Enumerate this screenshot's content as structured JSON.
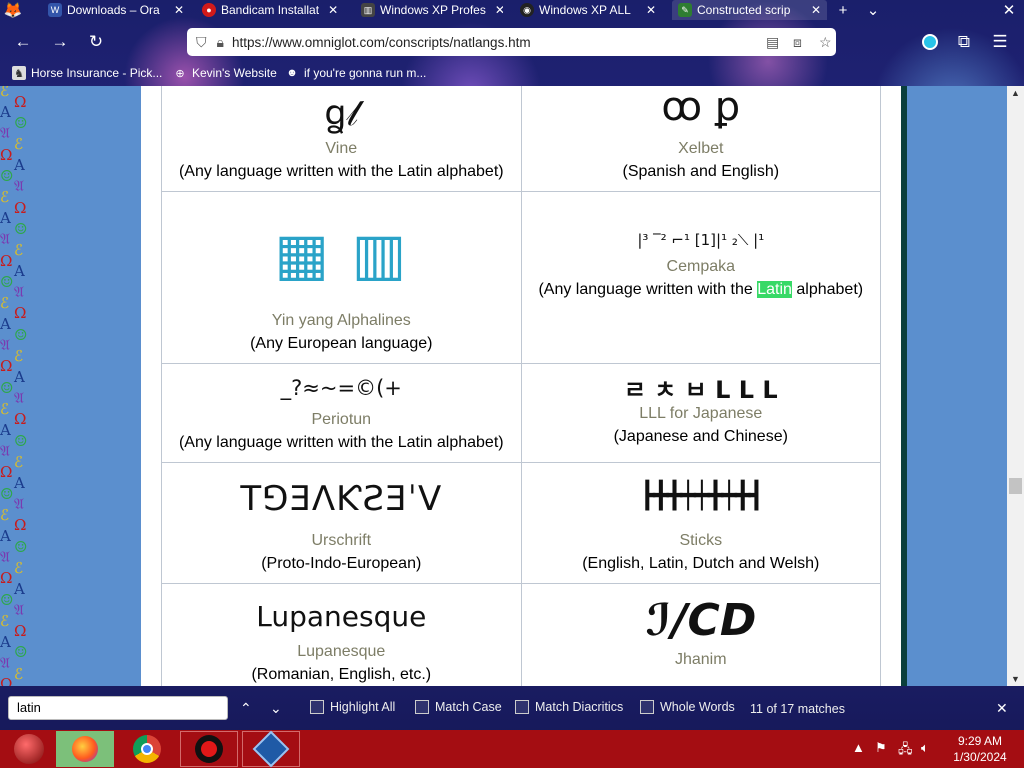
{
  "browser": {
    "tabs": [
      {
        "title": "Downloads – Ora",
        "icon": "document-icon",
        "icon_color": "#3355aa"
      },
      {
        "title": "Bandicam Installat",
        "icon": "bandicam-icon",
        "icon_color": "#d21a1a"
      },
      {
        "title": "Windows XP Profes",
        "icon": "library-icon",
        "icon_color": "#444444"
      },
      {
        "title": "Windows XP ALL",
        "icon": "github-icon",
        "icon_color": "#222222"
      },
      {
        "title": "Constructed scrip",
        "icon": "omniglot-icon",
        "icon_color": "#2e7d32"
      }
    ],
    "new_tab": "+",
    "address": "https://www.omniglot.com/conscripts/natlangs.htm",
    "bookmarks": [
      "Horse Insurance - Pick...",
      "Kevin's Website",
      "if you're gonna run m..."
    ]
  },
  "page": {
    "rows": [
      [
        {
          "glyph": "ꬶ𝓁",
          "name": "Vine",
          "langs": "(Any language written with the Latin alphabet)"
        },
        {
          "glyph": "ꝏ ꝑ",
          "name": "Xelbet",
          "langs": "(Spanish and English)"
        }
      ],
      [
        {
          "glyph": "▦ ▥",
          "name": "Yin yang Alphalines",
          "langs": "(Any European language)"
        },
        {
          "glyph": "|³ ‾² ⌐¹ [1]|¹ ₂⟍ |¹",
          "name": "Cempaka",
          "langs_before": "(Any language written with the ",
          "langs_highlight": "Latin",
          "langs_after": " alphabet)"
        }
      ],
      [
        {
          "glyph": "_?≈~=©(+",
          "name": "Periotun",
          "langs": "(Any language written with the Latin alphabet)"
        },
        {
          "glyph": "ㄹ ㅊ ㅂ L L L",
          "name": "LLL for Japanese",
          "langs": "(Japanese and Chinese)"
        }
      ],
      [
        {
          "glyph": "T⅁ƎɅƘƧƎˈV",
          "name": "Urschrift",
          "langs": "(Proto-Indo-European)"
        },
        {
          "glyph": "┣╋╋┿┿╋┿╋┫",
          "name": "Sticks",
          "langs": "(English, Latin, Dutch and Welsh)"
        }
      ],
      [
        {
          "glyph": "Lupanesque",
          "name": "Lupanesque",
          "langs": "(Romanian, English, etc.)"
        },
        {
          "glyph": "ℐ/CD",
          "name": "Jhanim",
          "langs": ""
        }
      ]
    ]
  },
  "findbar": {
    "query": "latin",
    "highlight_all": "Highlight All",
    "match_case": "Match Case",
    "match_diacritics": "Match Diacritics",
    "whole_words": "Whole Words",
    "result": "11 of 17 matches"
  },
  "taskbar": {
    "time": "9:29 AM",
    "date": "1/30/2024"
  },
  "colors": {
    "highlight": "#38d967",
    "taskbar": "#a40d12",
    "script_name": "#7d7d66",
    "content_bg": "#5b8fce"
  }
}
